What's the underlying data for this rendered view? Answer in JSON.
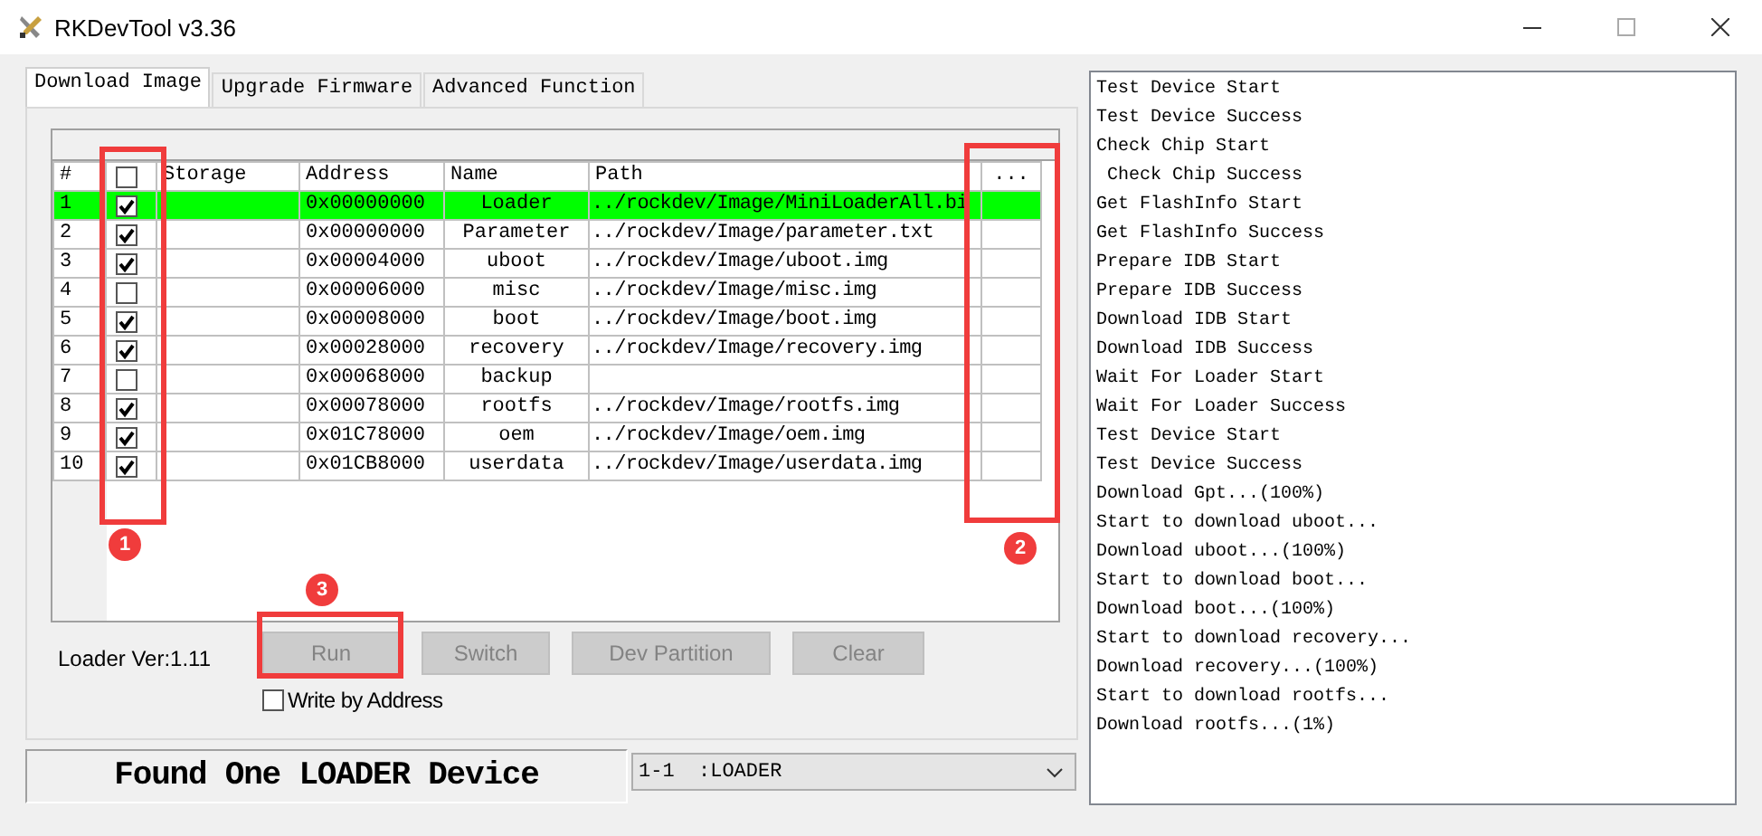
{
  "window": {
    "title": "RKDevTool v3.36"
  },
  "tabs": [
    {
      "label": "Download Image",
      "selected": true
    },
    {
      "label": "Upgrade Firmware",
      "selected": false
    },
    {
      "label": "Advanced Function",
      "selected": false
    }
  ],
  "table": {
    "columns": [
      "#",
      "Storage",
      "Address",
      "Name",
      "Path",
      "..."
    ],
    "all_checked": false,
    "rows": [
      {
        "index": "1",
        "checked": true,
        "selected": true,
        "address": "0x00000000",
        "name": "Loader",
        "path": "../rockdev/Image/MiniLoaderAll.bi"
      },
      {
        "index": "2",
        "checked": true,
        "selected": false,
        "address": "0x00000000",
        "name": "Parameter",
        "path": "../rockdev/Image/parameter.txt"
      },
      {
        "index": "3",
        "checked": true,
        "selected": false,
        "address": "0x00004000",
        "name": "uboot",
        "path": "../rockdev/Image/uboot.img"
      },
      {
        "index": "4",
        "checked": false,
        "selected": false,
        "address": "0x00006000",
        "name": "misc",
        "path": "../rockdev/Image/misc.img"
      },
      {
        "index": "5",
        "checked": true,
        "selected": false,
        "address": "0x00008000",
        "name": "boot",
        "path": "../rockdev/Image/boot.img"
      },
      {
        "index": "6",
        "checked": true,
        "selected": false,
        "address": "0x00028000",
        "name": "recovery",
        "path": "../rockdev/Image/recovery.img"
      },
      {
        "index": "7",
        "checked": false,
        "selected": false,
        "address": "0x00068000",
        "name": "backup",
        "path": ""
      },
      {
        "index": "8",
        "checked": true,
        "selected": false,
        "address": "0x00078000",
        "name": "rootfs",
        "path": "../rockdev/Image/rootfs.img"
      },
      {
        "index": "9",
        "checked": true,
        "selected": false,
        "address": "0x01C78000",
        "name": "oem",
        "path": "../rockdev/Image/oem.img"
      },
      {
        "index": "10",
        "checked": true,
        "selected": false,
        "address": "0x01CB8000",
        "name": "userdata",
        "path": "../rockdev/Image/userdata.img"
      }
    ]
  },
  "loader_version": "Loader Ver:1.11",
  "buttons": [
    {
      "label": "Run",
      "disabled": true
    },
    {
      "label": "Switch",
      "disabled": true
    },
    {
      "label": "Dev Partition",
      "disabled": true
    },
    {
      "label": "Clear",
      "disabled": true
    }
  ],
  "write_by_address": {
    "label": "Write by Address",
    "checked": false
  },
  "status": "Found One LOADER Device",
  "device_select": {
    "value": "1-1  :LOADER"
  },
  "log": [
    "Test Device Start",
    "Test Device Success",
    "Check Chip Start",
    " Check Chip Success",
    "Get FlashInfo Start",
    "Get FlashInfo Success",
    "Prepare IDB Start",
    "Prepare IDB Success",
    "Download IDB Start",
    "Download IDB Success",
    "Wait For Loader Start",
    "Wait For Loader Success",
    "Test Device Start",
    "Test Device Success",
    "Download Gpt...(100%)",
    "Start to download uboot...",
    "Download uboot...(100%)",
    "Start to download boot...",
    "Download boot...(100%)",
    "Start to download recovery...",
    "Download recovery...(100%)",
    "Start to download rootfs...",
    "Download rootfs...(1%)"
  ],
  "annotations": [
    {
      "label": "1"
    },
    {
      "label": "2"
    },
    {
      "label": "3"
    }
  ]
}
